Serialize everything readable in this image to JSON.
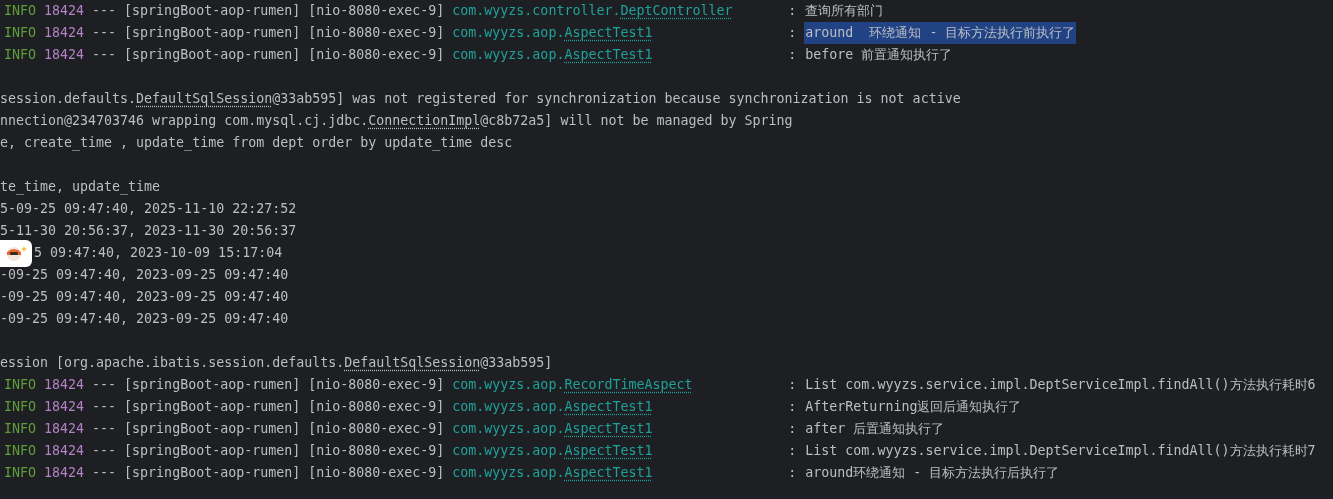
{
  "console": {
    "lines": [
      {
        "kind": "log",
        "level": "INFO",
        "pid": "18424",
        "separator": "---",
        "app": "[springBoot-aop-rumen]",
        "thread": "[nio-8080-exec-9]",
        "logger_package": "com.wyyzs.controller.",
        "logger_class": "DeptController",
        "colon": ":",
        "message": "查询所有部门",
        "selected": false
      },
      {
        "kind": "log",
        "level": "INFO",
        "pid": "18424",
        "separator": "---",
        "app": "[springBoot-aop-rumen]",
        "thread": "[nio-8080-exec-9]",
        "logger_package": "com.wyyzs.aop.",
        "logger_class": "AspectTest1",
        "colon": ":",
        "message": "around  环绕通知 - 目标方法执行前执行了",
        "selected": true
      },
      {
        "kind": "log",
        "level": "INFO",
        "pid": "18424",
        "separator": "---",
        "app": "[springBoot-aop-rumen]",
        "thread": "[nio-8080-exec-9]",
        "logger_package": "com.wyyzs.aop.",
        "logger_class": "AspectTest1",
        "colon": ":",
        "message": "before 前置通知执行了",
        "selected": false
      },
      {
        "kind": "blank"
      },
      {
        "kind": "plain",
        "segments": [
          {
            "text": "session.defaults.",
            "link": false
          },
          {
            "text": "DefaultSqlSession",
            "link": true
          },
          {
            "text": "@33ab595] was not registered for synchronization because synchronization is not active",
            "link": false
          }
        ]
      },
      {
        "kind": "plain",
        "segments": [
          {
            "text": "nnection@234703746 wrapping com.mysql.cj.jdbc.",
            "link": false
          },
          {
            "text": "ConnectionImpl",
            "link": true
          },
          {
            "text": "@c8b72a5] will not be managed by Spring",
            "link": false
          }
        ]
      },
      {
        "kind": "plain",
        "segments": [
          {
            "text": "e, create_time , update_time from dept order by update_time desc",
            "link": false
          }
        ]
      },
      {
        "kind": "blank"
      },
      {
        "kind": "plain",
        "segments": [
          {
            "text": "te_time, update_time",
            "link": false
          }
        ]
      },
      {
        "kind": "plain",
        "segments": [
          {
            "text": "5-09-25 09:47:40, 2025-11-10 22:27:52",
            "link": false
          }
        ]
      },
      {
        "kind": "plain",
        "segments": [
          {
            "text": "5-11-30 20:56:37, 2023-11-30 20:56:37",
            "link": false
          }
        ]
      },
      {
        "kind": "badge",
        "segments": [
          {
            "text": "5 09:47:40, 2023-10-09 15:17:04",
            "link": false
          }
        ]
      },
      {
        "kind": "plain",
        "segments": [
          {
            "text": "-09-25 09:47:40, 2023-09-25 09:47:40",
            "link": false
          }
        ]
      },
      {
        "kind": "plain",
        "segments": [
          {
            "text": "-09-25 09:47:40, 2023-09-25 09:47:40",
            "link": false
          }
        ]
      },
      {
        "kind": "plain",
        "segments": [
          {
            "text": "-09-25 09:47:40, 2023-09-25 09:47:40",
            "link": false
          }
        ]
      },
      {
        "kind": "blank"
      },
      {
        "kind": "plain",
        "segments": [
          {
            "text": "ession [org.apache.ibatis.session.defaults.",
            "link": false
          },
          {
            "text": "DefaultSqlSession",
            "link": true
          },
          {
            "text": "@33ab595]",
            "link": false
          }
        ]
      },
      {
        "kind": "log",
        "level": "INFO",
        "pid": "18424",
        "separator": "---",
        "app": "[springBoot-aop-rumen]",
        "thread": "[nio-8080-exec-9]",
        "logger_package": "com.wyyzs.aop.",
        "logger_class": "RecordTimeAspect",
        "colon": ":",
        "message": "List com.wyyzs.service.impl.DeptServiceImpl.findAll()方法执行耗时6",
        "selected": false
      },
      {
        "kind": "log",
        "level": "INFO",
        "pid": "18424",
        "separator": "---",
        "app": "[springBoot-aop-rumen]",
        "thread": "[nio-8080-exec-9]",
        "logger_package": "com.wyyzs.aop.",
        "logger_class": "AspectTest1",
        "colon": ":",
        "message": "AfterReturning返回后通知执行了",
        "selected": false
      },
      {
        "kind": "log",
        "level": "INFO",
        "pid": "18424",
        "separator": "---",
        "app": "[springBoot-aop-rumen]",
        "thread": "[nio-8080-exec-9]",
        "logger_package": "com.wyyzs.aop.",
        "logger_class": "AspectTest1",
        "colon": ":",
        "message": "after 后置通知执行了",
        "selected": false
      },
      {
        "kind": "log",
        "level": "INFO",
        "pid": "18424",
        "separator": "---",
        "app": "[springBoot-aop-rumen]",
        "thread": "[nio-8080-exec-9]",
        "logger_package": "com.wyyzs.aop.",
        "logger_class": "AspectTest1",
        "colon": ":",
        "message": "List com.wyyzs.service.impl.DeptServiceImpl.findAll()方法执行耗时7",
        "selected": false
      },
      {
        "kind": "log",
        "level": "INFO",
        "pid": "18424",
        "separator": "---",
        "app": "[springBoot-aop-rumen]",
        "thread": "[nio-8080-exec-9]",
        "logger_package": "com.wyyzs.aop.",
        "logger_class": "AspectTest1",
        "colon": ":",
        "message": "around环绕通知 - 目标方法执行后执行了",
        "selected": false
      }
    ]
  }
}
